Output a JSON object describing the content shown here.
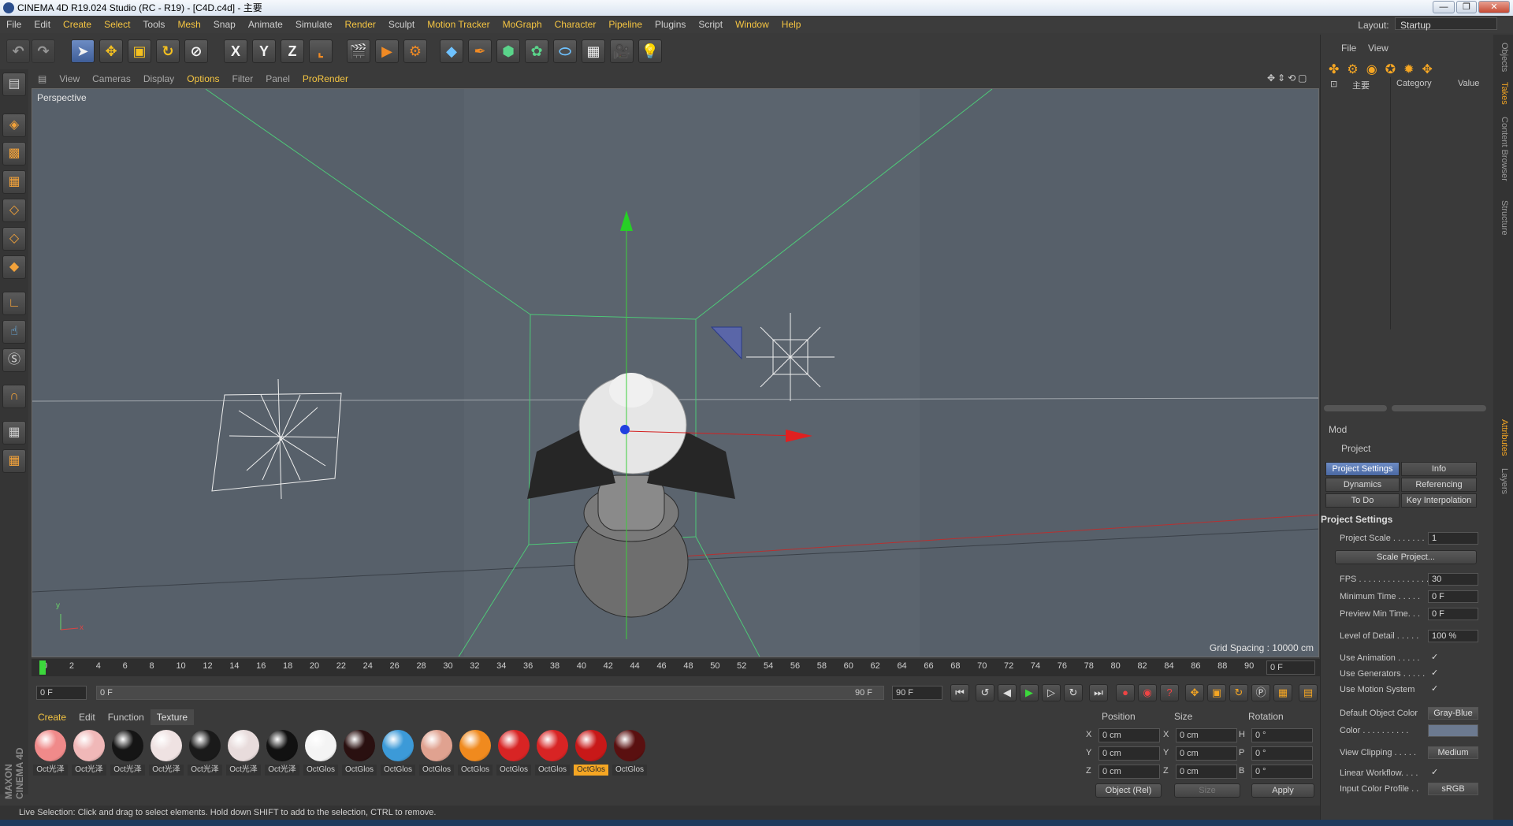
{
  "window": {
    "title": "CINEMA 4D R19.024 Studio (RC - R19) - [C4D.c4d] - 主要",
    "controls": [
      "—",
      "❐",
      "✕"
    ]
  },
  "menubar": {
    "items": [
      {
        "label": "File",
        "hl": false
      },
      {
        "label": "Edit",
        "hl": false
      },
      {
        "label": "Create",
        "hl": true
      },
      {
        "label": "Select",
        "hl": true
      },
      {
        "label": "Tools",
        "hl": false
      },
      {
        "label": "Mesh",
        "hl": true
      },
      {
        "label": "Snap",
        "hl": false
      },
      {
        "label": "Animate",
        "hl": false
      },
      {
        "label": "Simulate",
        "hl": false
      },
      {
        "label": "Render",
        "hl": true
      },
      {
        "label": "Sculpt",
        "hl": false
      },
      {
        "label": "Motion Tracker",
        "hl": true
      },
      {
        "label": "MoGraph",
        "hl": true
      },
      {
        "label": "Character",
        "hl": true
      },
      {
        "label": "Pipeline",
        "hl": true
      },
      {
        "label": "Plugins",
        "hl": false
      },
      {
        "label": "Script",
        "hl": false
      },
      {
        "label": "Window",
        "hl": true
      },
      {
        "label": "Help",
        "hl": true
      }
    ],
    "layout_label": "Layout:",
    "layout_value": "Startup"
  },
  "toolbar": {
    "axes": [
      "X",
      "Y",
      "Z"
    ]
  },
  "viewport": {
    "menu": [
      {
        "label": "View",
        "hl": false
      },
      {
        "label": "Cameras",
        "hl": false
      },
      {
        "label": "Display",
        "hl": false
      },
      {
        "label": "Options",
        "hl": true
      },
      {
        "label": "Filter",
        "hl": false
      },
      {
        "label": "Panel",
        "hl": false
      },
      {
        "label": "ProRender",
        "hl": true
      }
    ],
    "label": "Perspective",
    "grid_spacing": "Grid Spacing : 10000 cm",
    "axis_y": "y",
    "axis_x": "x"
  },
  "timeline": {
    "ticks": [
      "0",
      "2",
      "4",
      "6",
      "8",
      "10",
      "12",
      "14",
      "16",
      "18",
      "20",
      "22",
      "24",
      "26",
      "28",
      "30",
      "32",
      "34",
      "36",
      "38",
      "40",
      "42",
      "44",
      "46",
      "48",
      "50",
      "52",
      "54",
      "56",
      "58",
      "60",
      "62",
      "64",
      "66",
      "68",
      "70",
      "72",
      "74",
      "76",
      "78",
      "80",
      "82",
      "84",
      "86",
      "88",
      "90"
    ],
    "current_frame": "0 F",
    "start": "0 F",
    "range_start": "0 F",
    "range_end": "90 F",
    "end": "90 F"
  },
  "materials": {
    "menu": [
      {
        "label": "Create",
        "hl": true
      },
      {
        "label": "Edit",
        "hl": false
      },
      {
        "label": "Function",
        "hl": false
      },
      {
        "label": "Texture",
        "hl": false
      }
    ],
    "items": [
      {
        "label": "Oct光泽",
        "color": "#f08a8a"
      },
      {
        "label": "Oct光泽",
        "color": "#f0b8b8"
      },
      {
        "label": "Oct光泽",
        "color": "#151515"
      },
      {
        "label": "Oct光泽",
        "color": "#efe2e2"
      },
      {
        "label": "Oct光泽",
        "color": "#1a1a1a"
      },
      {
        "label": "Oct光泽",
        "color": "#e8dcdc"
      },
      {
        "label": "Oct光泽",
        "color": "#111111"
      },
      {
        "label": "OctGlos",
        "color": "#f4f4f4"
      },
      {
        "label": "OctGlos",
        "color": "#2a1010"
      },
      {
        "label": "OctGlos",
        "color": "#3c9ad8"
      },
      {
        "label": "OctGlos",
        "color": "#e0a290"
      },
      {
        "label": "OctGlos",
        "color": "#f08a1e"
      },
      {
        "label": "OctGlos",
        "color": "#d82424"
      },
      {
        "label": "OctGlos",
        "color": "#d82424"
      },
      {
        "label": "OctGlos",
        "color": "#c81818",
        "selected": true
      },
      {
        "label": "OctGlos",
        "color": "#5a1010"
      }
    ]
  },
  "coordinates": {
    "headers": [
      "Position",
      "Size",
      "Rotation"
    ],
    "rows": [
      {
        "pl": "X",
        "pv": "0 cm",
        "sl": "X",
        "sv": "0 cm",
        "rl": "H",
        "rv": "0 °"
      },
      {
        "pl": "Y",
        "pv": "0 cm",
        "sl": "Y",
        "sv": "0 cm",
        "rl": "P",
        "rv": "0 °"
      },
      {
        "pl": "Z",
        "pv": "0 cm",
        "sl": "Z",
        "sv": "0 cm",
        "rl": "B",
        "rv": "0 °"
      }
    ],
    "mode": "Object (Rel)",
    "size_mode": "Size",
    "apply": "Apply"
  },
  "status": "Live Selection: Click and drag to select elements. Hold down SHIFT to add to the selection, CTRL to remove.",
  "objects": {
    "menu": [
      "File",
      "View"
    ],
    "root": "主要",
    "col_category": "Category",
    "col_value": "Value"
  },
  "attributes": {
    "mode": "Mod",
    "object": "Project",
    "tabs": [
      "Project Settings",
      "Info",
      "Dynamics",
      "Referencing",
      "To Do",
      "Key Interpolation"
    ],
    "section": "Project Settings",
    "scale_project": "Scale Project...",
    "rows": [
      {
        "label": "Project Scale . . . . . . .",
        "value": "1",
        "kind": "field"
      },
      {
        "label": "FPS . . . . . . . . . . . . . . .",
        "value": "30",
        "kind": "field"
      },
      {
        "label": "Minimum Time . . . . .",
        "value": "0 F",
        "kind": "field"
      },
      {
        "label": "Preview Min Time. . .",
        "value": "0 F",
        "kind": "field"
      },
      {
        "label": "Level of Detail . . . . .",
        "value": "100 %",
        "kind": "field"
      },
      {
        "label": "Use Animation . . . . .",
        "value": "✓",
        "kind": "check"
      },
      {
        "label": "Use Generators . . . . .",
        "value": "✓",
        "kind": "check"
      },
      {
        "label": "Use Motion System",
        "value": "✓",
        "kind": "check"
      },
      {
        "label": "Default Object Color",
        "value": "Gray-Blue",
        "kind": "btn"
      },
      {
        "label": "Color . . . . . . . . . .",
        "value": "",
        "kind": "swatch"
      },
      {
        "label": "View Clipping . . . . .",
        "value": "Medium",
        "kind": "btn"
      },
      {
        "label": "Linear Workflow. . . .",
        "value": "✓",
        "kind": "check"
      },
      {
        "label": "Input Color Profile . .",
        "value": "sRGB",
        "kind": "btn"
      }
    ]
  },
  "side_tabs": [
    {
      "label": "Objects",
      "on": false
    },
    {
      "label": "Takes",
      "on": true
    },
    {
      "label": "Content Browser",
      "on": false
    },
    {
      "label": "Structure",
      "on": false
    },
    {
      "label": "Attributes",
      "on": true
    },
    {
      "label": "Layers",
      "on": false
    }
  ],
  "maxon_logo": "MAXON CINEMA 4D"
}
